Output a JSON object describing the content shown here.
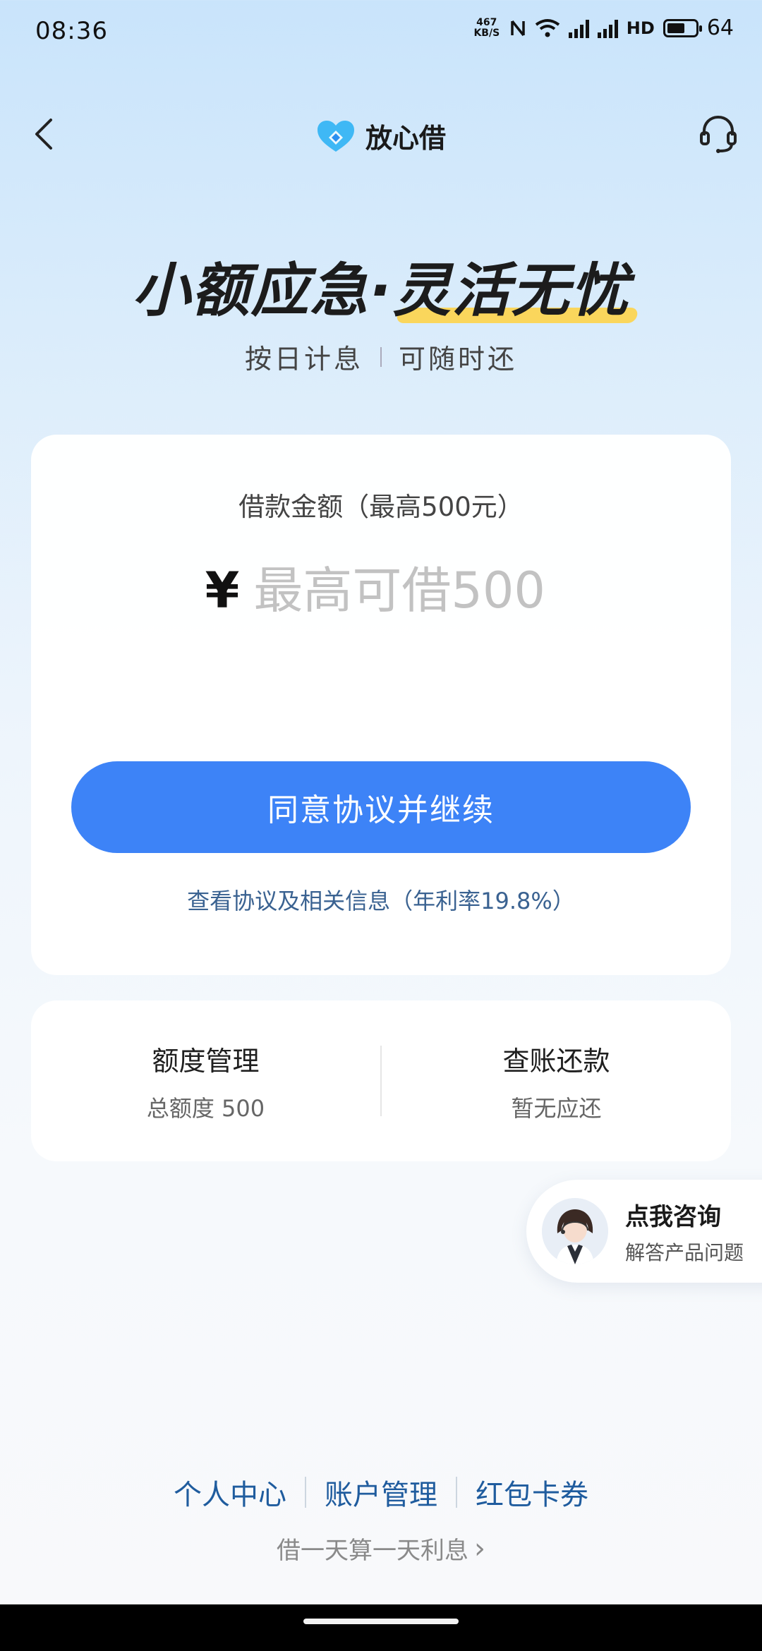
{
  "status_bar": {
    "time": "08:36",
    "net_speed_value": "467",
    "net_speed_unit": "KB/S",
    "hd_label": "HD",
    "battery_level": "64",
    "battery_fraction": 0.64,
    "icons": [
      "nfc-icon",
      "wifi-icon",
      "signal-4g-icon",
      "signal-4g-icon",
      "battery-icon"
    ]
  },
  "nav": {
    "brand_name": "放心借",
    "back_icon": "chevron-left-icon",
    "support_icon": "headset-icon"
  },
  "hero": {
    "title_part1": "小额应急·",
    "title_part2": "灵活无忧",
    "sub_left": "按日计息",
    "sub_right": "可随时还"
  },
  "loan_card": {
    "label": "借款金额（最高500元）",
    "currency": "¥",
    "amount_placeholder": "最高可借500",
    "amount_value": "",
    "agree_button": "同意协议并继续",
    "protocol_link": "查看协议及相关信息（年利率19.8%）"
  },
  "quota_card": {
    "left_title": "额度管理",
    "left_sub": "总额度 500",
    "right_title": "查账还款",
    "right_sub": "暂无应还"
  },
  "consult": {
    "title": "点我咨询",
    "subtitle": "解答产品问题"
  },
  "bottom_links": {
    "personal_center": "个人中心",
    "account_management": "账户管理",
    "coupons": "红包卡券"
  },
  "footer": {
    "note": "借一天算一天利息",
    "arrow": "›"
  },
  "colors": {
    "primary_button": "#3d83f7",
    "link": "#1f5c9e",
    "highlight": "#ffd23f"
  }
}
